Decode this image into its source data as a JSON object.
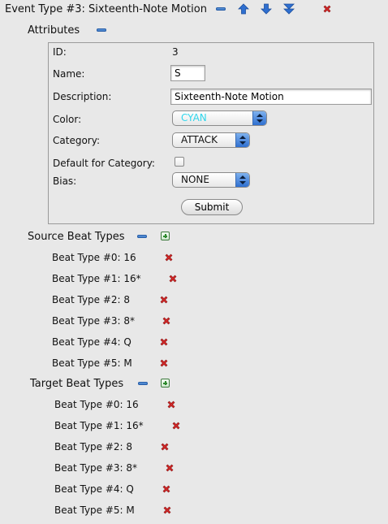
{
  "header": {
    "title": "Event Type #3: Sixteenth-Note Motion"
  },
  "attributes": {
    "label": "Attributes",
    "id_label": "ID:",
    "id_value": "3",
    "name_label": "Name:",
    "name_value": "S",
    "description_label": "Description:",
    "description_value": "Sixteenth-Note Motion",
    "color_label": "Color:",
    "color_value": "CYAN",
    "color_hex": "#2fd6ec",
    "category_label": "Category:",
    "category_value": "ATTACK",
    "default_label": "Default for Category:",
    "default_checked": false,
    "bias_label": "Bias:",
    "bias_value": "NONE",
    "submit_label": "Submit"
  },
  "source": {
    "label": "Source Beat Types",
    "items": [
      {
        "label": "Beat Type #0: 16"
      },
      {
        "label": "Beat Type #1: 16*"
      },
      {
        "label": "Beat Type #2: 8"
      },
      {
        "label": "Beat Type #3: 8*"
      },
      {
        "label": "Beat Type #4: Q"
      },
      {
        "label": "Beat Type #5: M"
      }
    ]
  },
  "target": {
    "label": "Target Beat Types",
    "items": [
      {
        "label": "Beat Type #0: 16"
      },
      {
        "label": "Beat Type #1: 16*"
      },
      {
        "label": "Beat Type #2: 8"
      },
      {
        "label": "Beat Type #3: 8*"
      },
      {
        "label": "Beat Type #4: Q"
      },
      {
        "label": "Beat Type #5: M"
      }
    ]
  },
  "colors": {
    "delete_red": "#d42a2a",
    "arrow_blue": "#2f6fd0"
  }
}
